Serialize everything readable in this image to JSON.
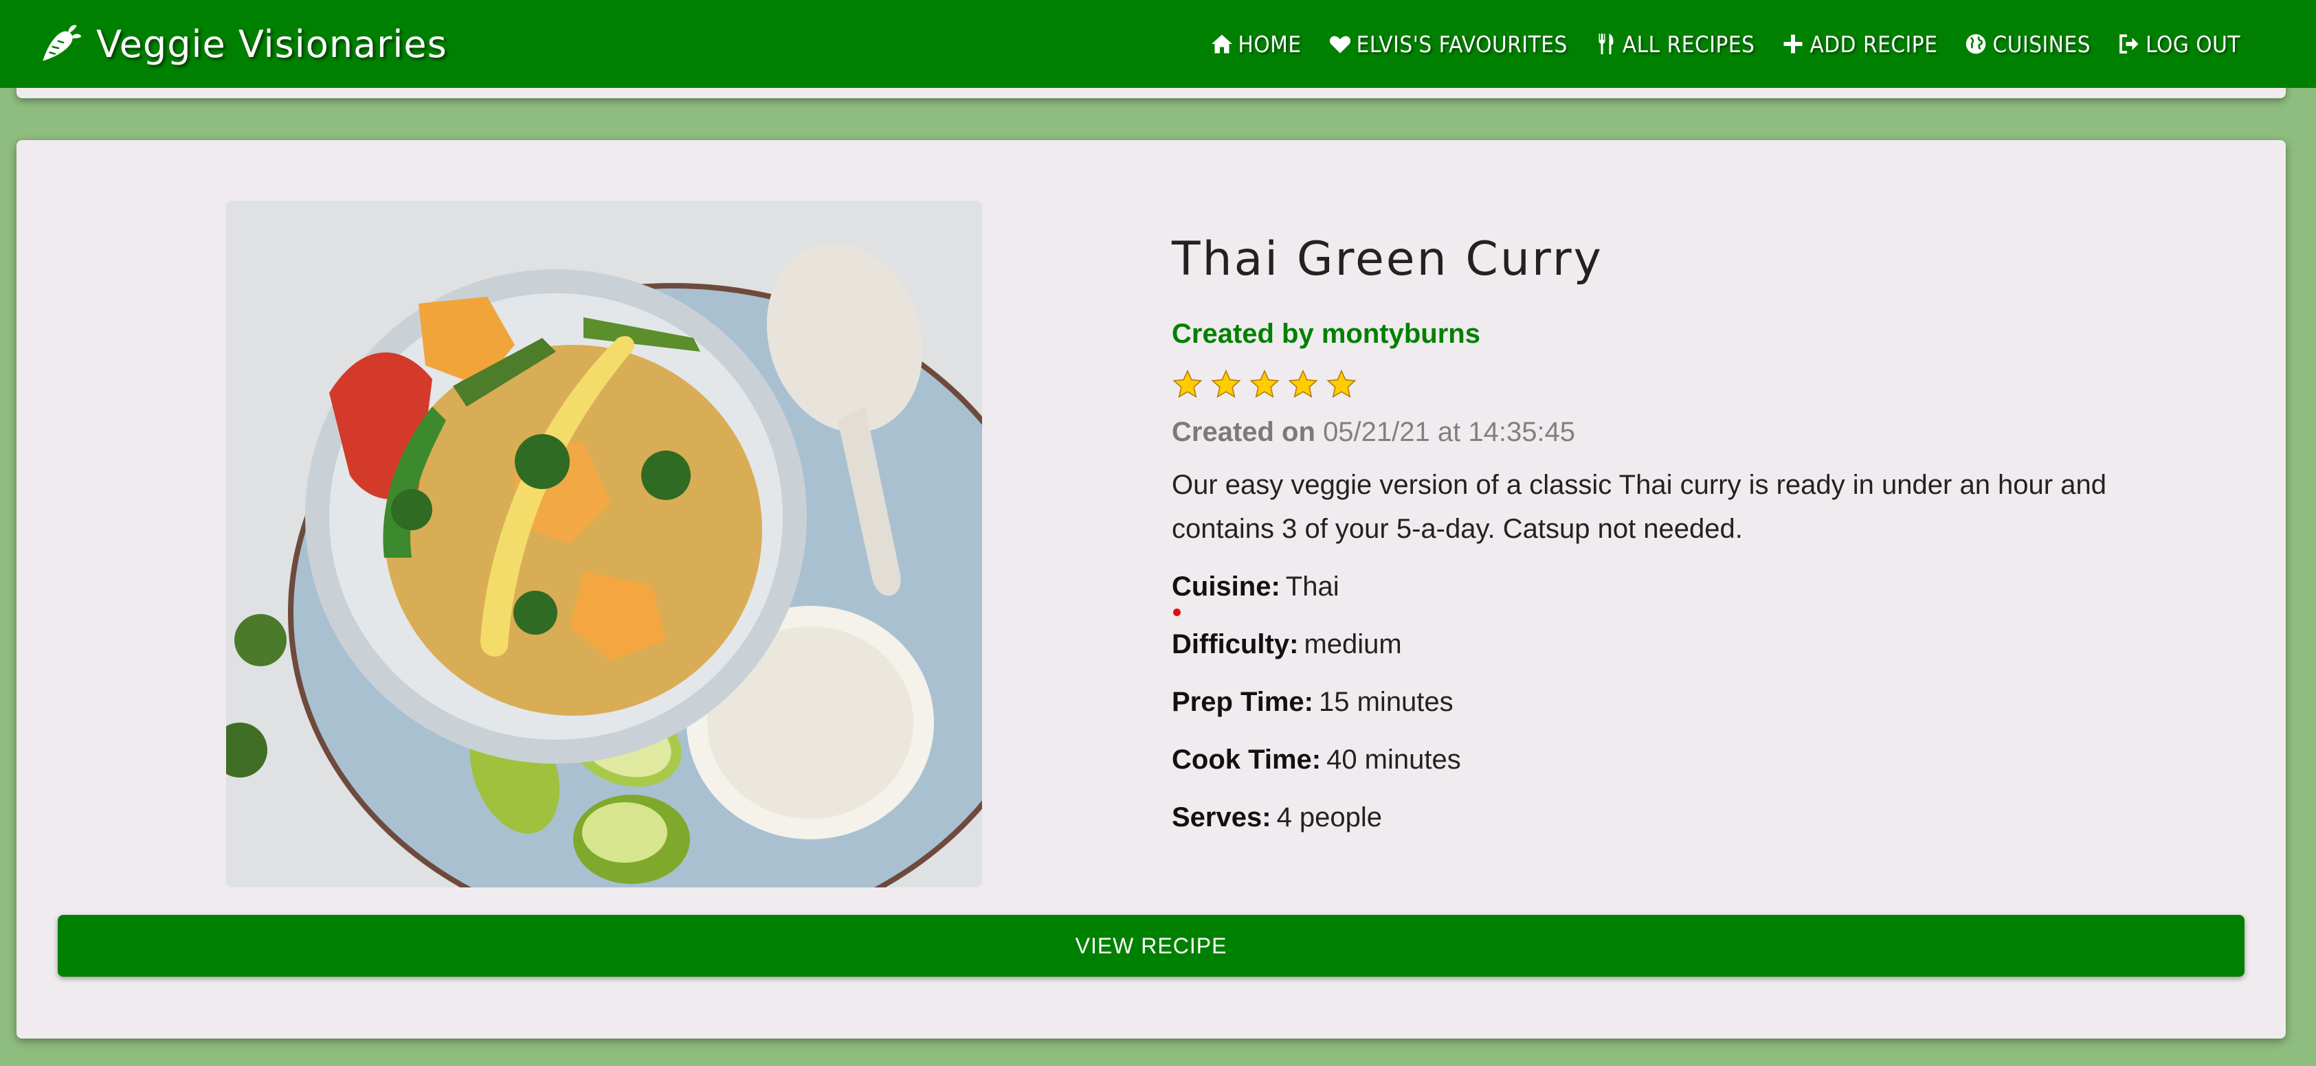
{
  "brand": {
    "name": "Veggie Visionaries",
    "icon": "carrot-icon"
  },
  "nav": [
    {
      "label": "HOME",
      "icon": "home-icon"
    },
    {
      "label": "ELVIS'S FAVOURITES",
      "icon": "heart-icon"
    },
    {
      "label": "ALL RECIPES",
      "icon": "cutlery-icon"
    },
    {
      "label": "ADD RECIPE",
      "icon": "plus-icon"
    },
    {
      "label": "CUISINES",
      "icon": "globe-icon"
    },
    {
      "label": "LOG OUT",
      "icon": "logout-icon"
    }
  ],
  "recipe": {
    "title": "Thai Green Curry",
    "creator": "Created by montyburns",
    "rating": 5,
    "rating_max": 5,
    "created_label": "Created on",
    "created_value": "05/21/21 at 14:35:45",
    "description": "Our easy veggie version of a classic Thai curry is ready in under an hour and contains 3 of your 5-a-day. Catsup not needed.",
    "fields": [
      {
        "label": "Cuisine:",
        "value": "Thai"
      },
      {
        "label": "Difficulty:",
        "value": "medium"
      },
      {
        "label": "Prep Time:",
        "value": "15 minutes"
      },
      {
        "label": "Cook Time:",
        "value": "40 minutes"
      },
      {
        "label": "Serves:",
        "value": "4 people"
      }
    ],
    "button_label": "VIEW RECIPE"
  },
  "colors": {
    "primary": "#008000",
    "page_background": "#8fbc7f",
    "card_background": "#f0ebef",
    "star": "#ffcc00"
  }
}
